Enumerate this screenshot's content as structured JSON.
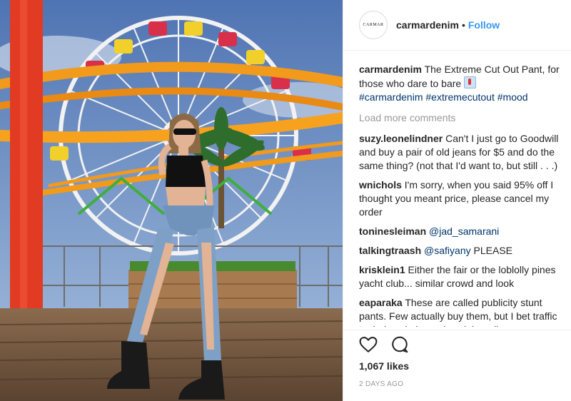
{
  "header": {
    "avatar_text": "CARMAR",
    "username": "carmardenim",
    "separator": "•",
    "follow_label": "Follow"
  },
  "caption": {
    "username": "carmardenim",
    "text": "The Extreme Cut Out Pant, for those who dare to bare",
    "emoji_icon": "person-emoji-icon",
    "hashtags": "#carmardenim #extremecutout #mood"
  },
  "load_more_label": "Load more comments",
  "comments": [
    {
      "user": "suzy.leonelindner",
      "mention": "",
      "text": "Can't I just go to Goodwill and buy a pair of old jeans for $5 and do the same thing? (not that I'd want to, but still . . .)"
    },
    {
      "user": "wnichols",
      "mention": "",
      "text": "I'm sorry, when you said 95% off I thought you meant price, please cancel my order"
    },
    {
      "user": "toninesleiman",
      "mention": "@jad_samarani",
      "text": ""
    },
    {
      "user": "talkingtraash",
      "mention": "@safiyany",
      "text": "PLEASE"
    },
    {
      "user": "krisklein1",
      "mention": "",
      "text": "Either the fair or the loblolly pines yacht club... similar crowd and look"
    },
    {
      "user": "eaparaka",
      "mention": "",
      "text": "These are called publicity stunt pants. Few actually buy them, but I bet traffic to their website and social media"
    }
  ],
  "likes": "1,067 likes",
  "timestamp": "2 DAYS AGO",
  "colors": {
    "link_blue": "#3897f0",
    "hashtag_blue": "#003569",
    "muted": "#999999",
    "text": "#262626"
  }
}
